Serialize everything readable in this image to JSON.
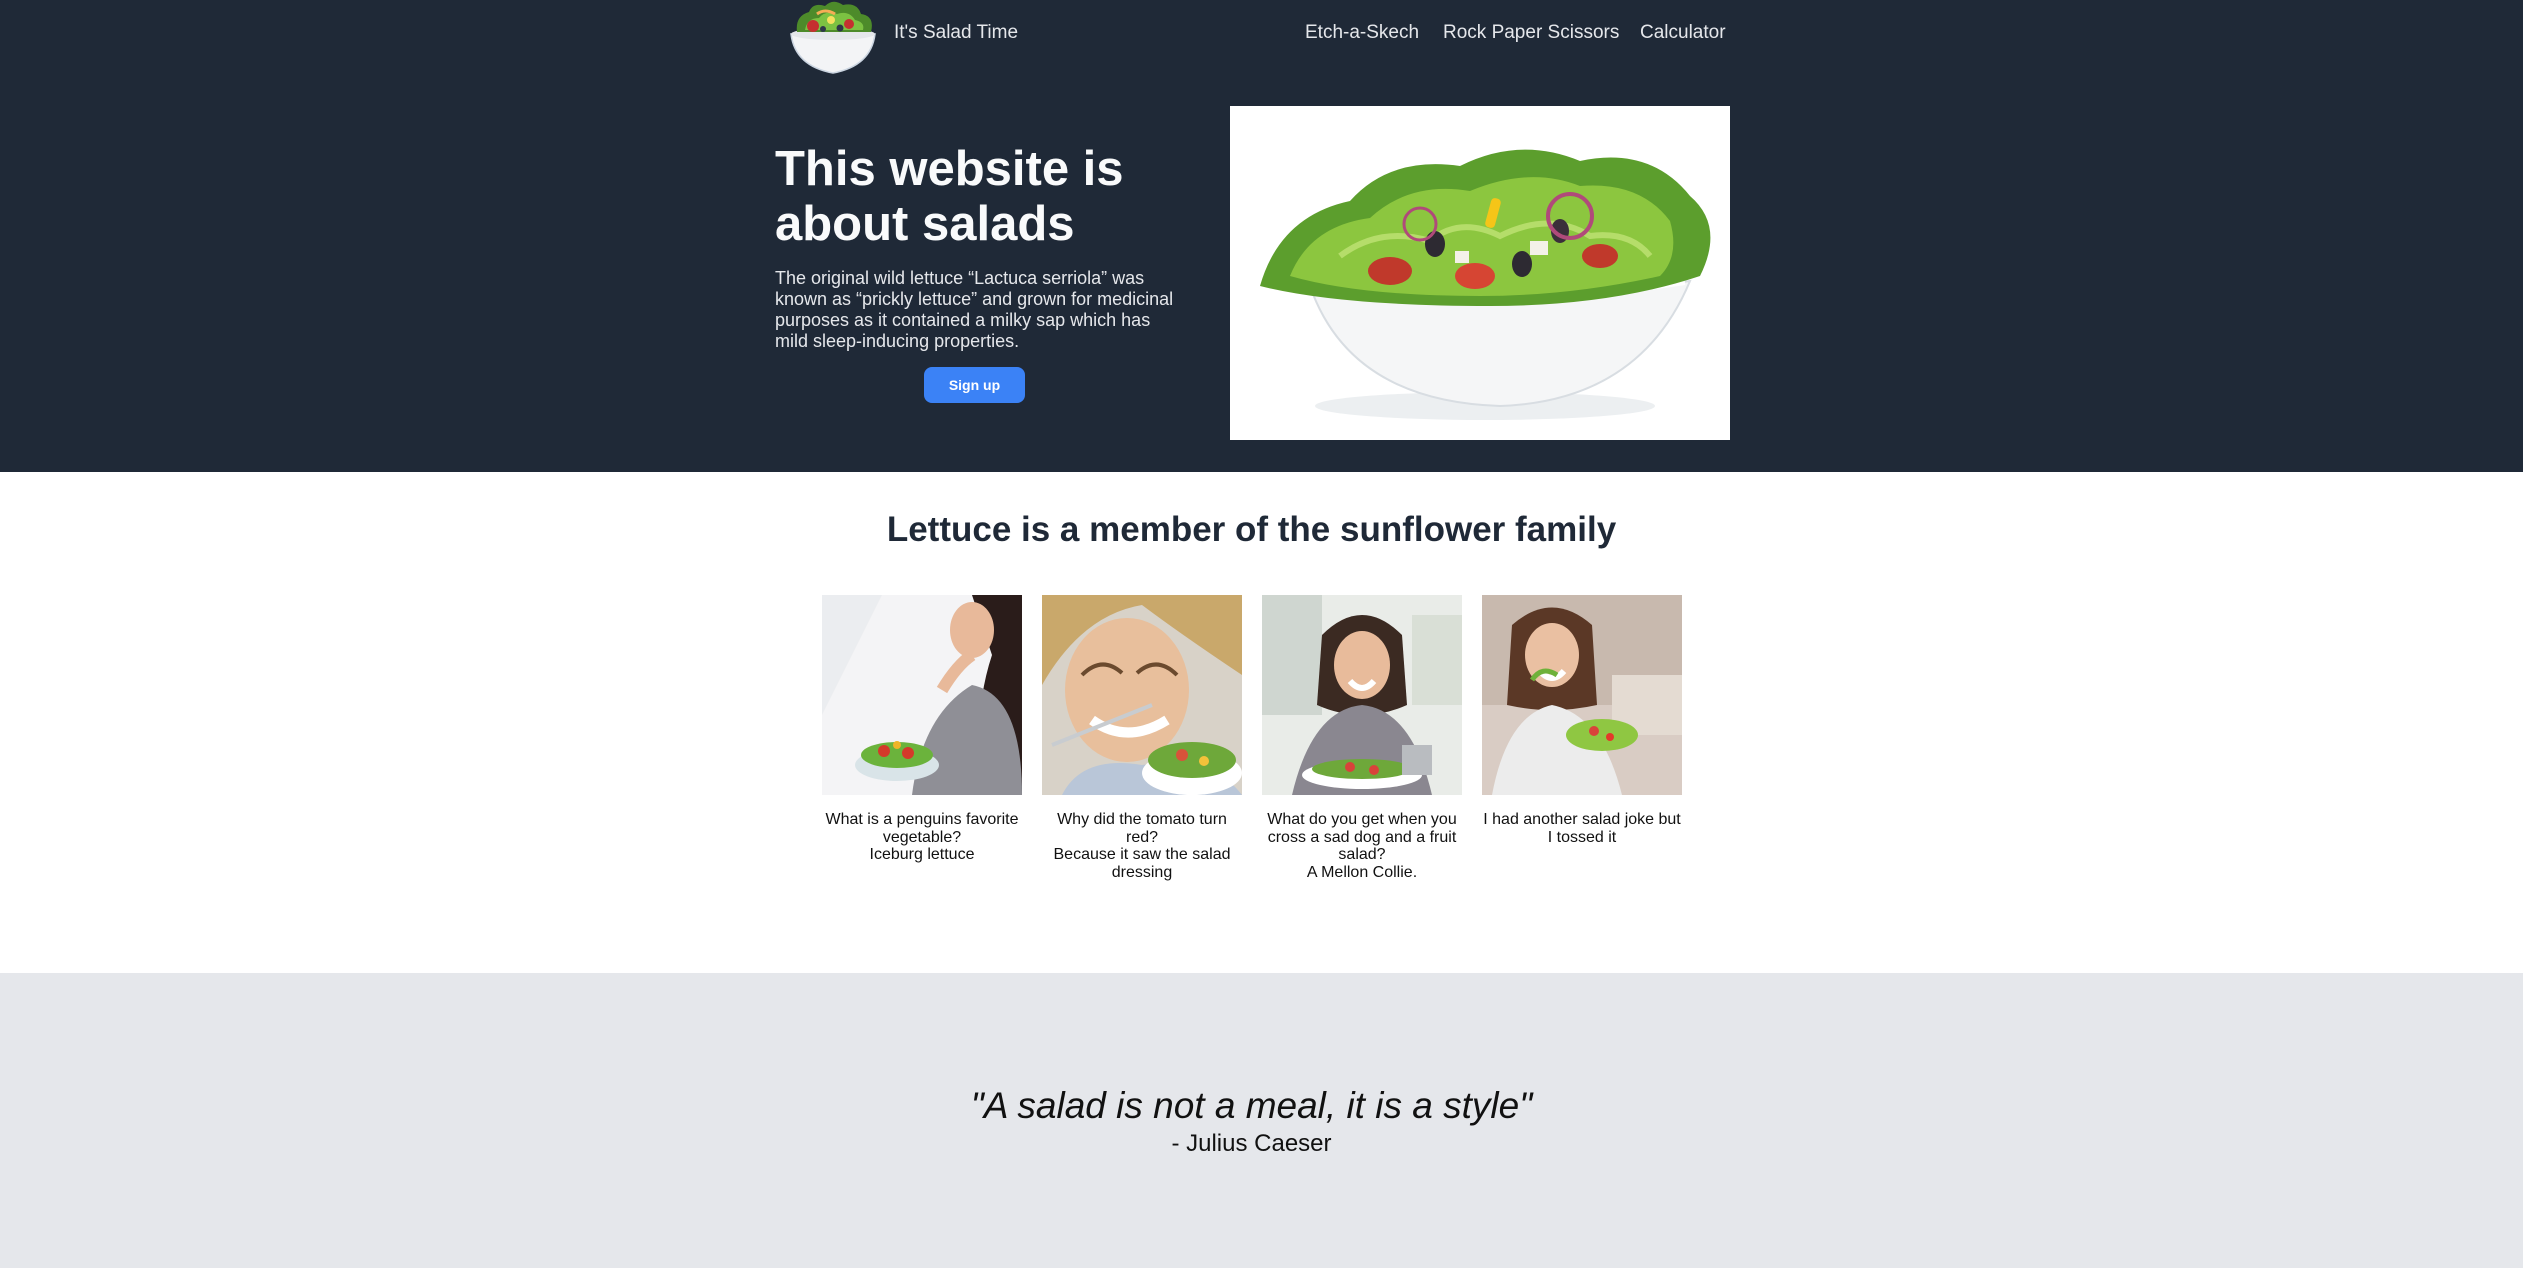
{
  "header": {
    "brand": "It's Salad Time",
    "nav": [
      "Etch-a-Skech",
      "Rock Paper Scissors",
      "Calculator"
    ]
  },
  "hero": {
    "title": "This website is about salads",
    "text": "The original wild lettuce “Lactuca serriola” was known as “prickly lettuce” and grown for medicinal purposes as it contained a milky sap which has mild sleep-inducing properties.",
    "cta": "Sign up"
  },
  "section": {
    "title": "Lettuce is a member of the sunflower family",
    "cards": [
      {
        "lines": [
          "What is a penguins favorite vegetable?",
          "Iceburg lettuce"
        ]
      },
      {
        "lines": [
          "Why did the tomato turn red?",
          "Because it saw the salad dressing"
        ]
      },
      {
        "lines": [
          "What do you get when you cross a sad dog and a fruit salad?",
          "A Mellon Collie."
        ]
      },
      {
        "lines": [
          "I had another salad joke but I tossed it"
        ]
      }
    ]
  },
  "quote": {
    "text": "\"A salad is not a meal, it is a style\"",
    "author": "- Julius Caeser"
  },
  "colors": {
    "header_bg": "#1f2937",
    "accent": "#3b82f6",
    "quote_bg": "#e5e7eb"
  }
}
